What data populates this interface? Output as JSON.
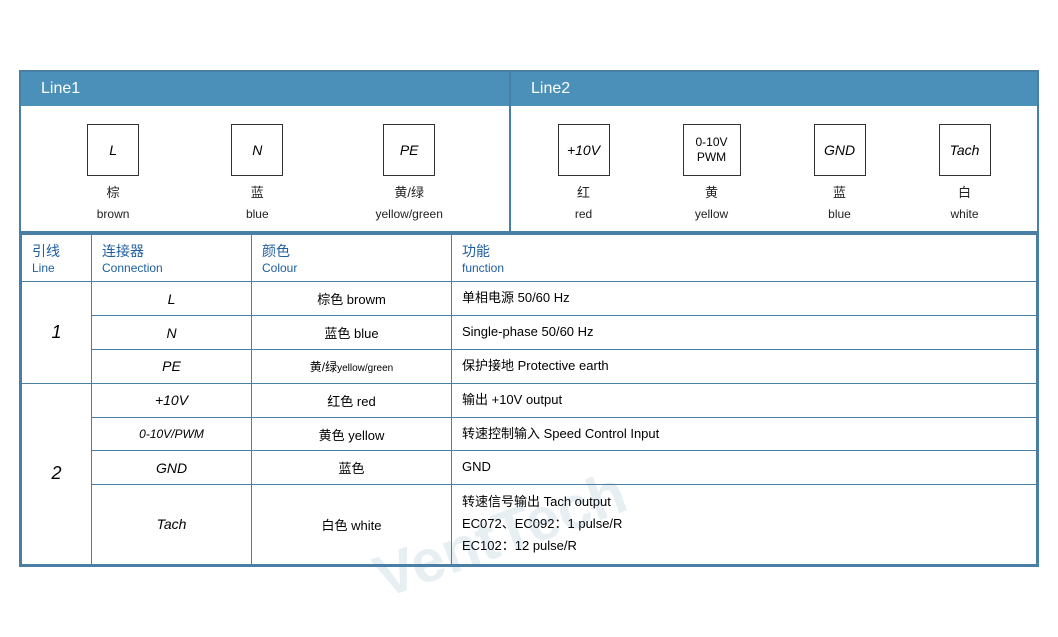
{
  "header": {
    "line1_label": "Line1",
    "line2_label": "Line2"
  },
  "diagram": {
    "line1_connectors": [
      {
        "box_label": "L",
        "zh": "棕",
        "en": "brown"
      },
      {
        "box_label": "N",
        "zh": "蓝",
        "en": "blue"
      },
      {
        "box_label": "PE",
        "zh": "黄/绿",
        "en": "yellow/green"
      }
    ],
    "line2_connectors": [
      {
        "box_label": "+10V",
        "zh": "红",
        "en": "red"
      },
      {
        "box_label": "0-10V\nPWM",
        "zh": "黄",
        "en": "yellow"
      },
      {
        "box_label": "GND",
        "zh": "蓝",
        "en": "blue"
      },
      {
        "box_label": "Tach",
        "zh": "白",
        "en": "white"
      }
    ]
  },
  "table": {
    "headers": {
      "line_zh": "引线",
      "line_en": "Line",
      "conn_zh": "连接器",
      "conn_en": "Connection",
      "colour_zh": "颜色",
      "colour_en": "Colour",
      "func_zh": "功能",
      "func_en": "function"
    },
    "rows": [
      {
        "line": "1",
        "rowspan": 3,
        "entries": [
          {
            "conn": "L",
            "colour": "棕色 browm",
            "func": "单相电源 50/60 Hz"
          },
          {
            "conn": "N",
            "colour": "蓝色 blue",
            "func": "Single-phase 50/60 Hz"
          },
          {
            "conn": "PE",
            "colour": "黄/绿yellow/green",
            "func": "保护接地 Protective earth"
          }
        ]
      },
      {
        "line": "2",
        "rowspan": 4,
        "entries": [
          {
            "conn": "+10V",
            "colour": "红色 red",
            "func": "输出 +10V output"
          },
          {
            "conn": "0-10V/PWM",
            "colour": "黄色 yellow",
            "func": "转速控制输入 Speed Control Input"
          },
          {
            "conn": "GND",
            "colour": "蓝色",
            "func": "GND"
          },
          {
            "conn": "Tach",
            "colour": "白色 white",
            "func": "转速信号输出 Tach output\nEC072、EC092：1 pulse/R\nEC102：12 pulse/R"
          }
        ]
      }
    ]
  }
}
